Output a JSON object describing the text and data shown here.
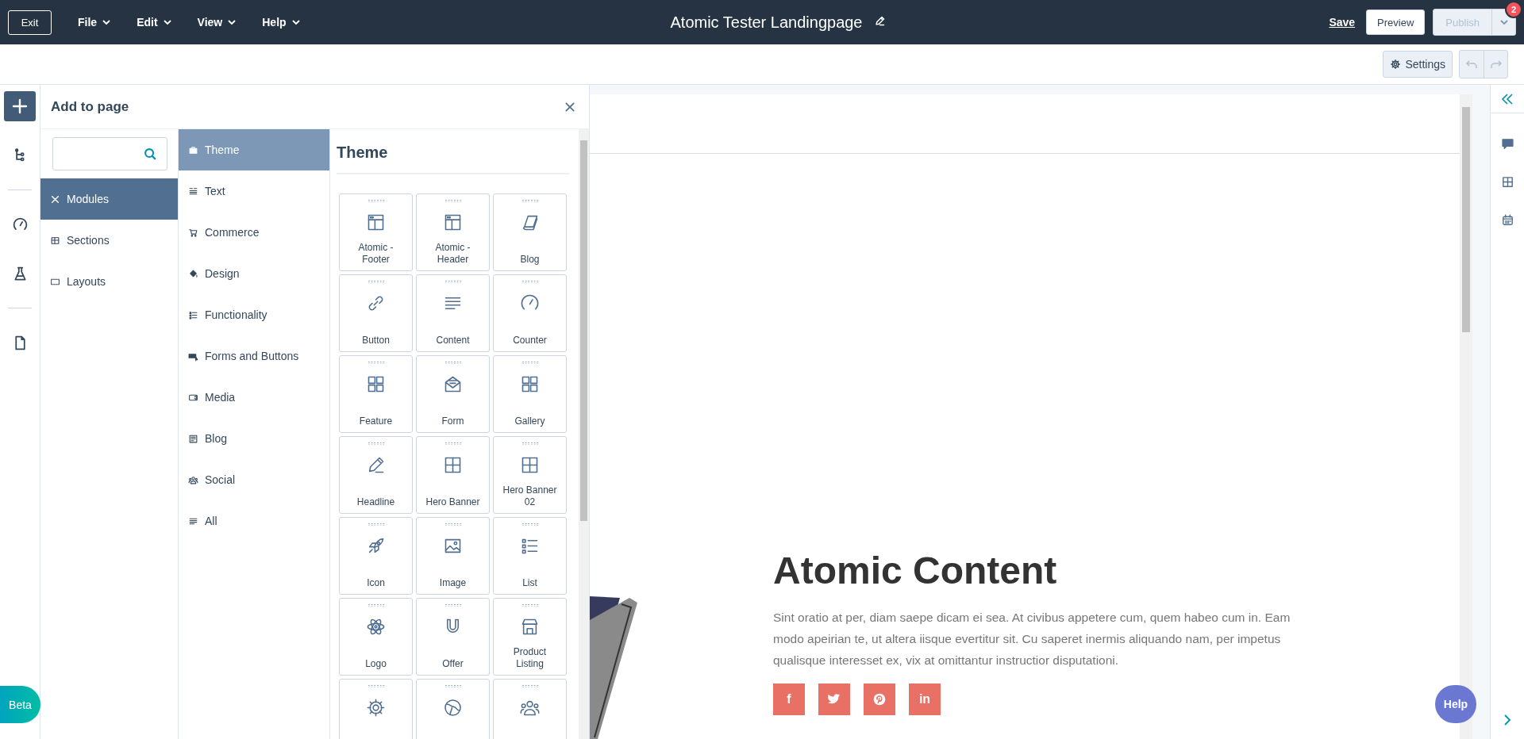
{
  "top_bar": {
    "exit": "Exit",
    "menus": [
      "File",
      "Edit",
      "View",
      "Help"
    ],
    "title": "Atomic Tester Landingpage",
    "save": "Save",
    "preview": "Preview",
    "publish": {
      "label": "Publish",
      "disabled": true
    },
    "notification_count": "2"
  },
  "toolbar": {
    "settings": "Settings"
  },
  "left_rail": [
    {
      "kind": "plus",
      "selected": true
    },
    {
      "kind": "tree",
      "selected": false
    },
    {
      "kind": "gauge",
      "selected": false
    },
    {
      "kind": "flask",
      "selected": false
    },
    {
      "kind": "file",
      "selected": false
    }
  ],
  "panel": {
    "title": "Add to page",
    "categories": [
      {
        "label": "Modules",
        "kind": "cross",
        "selected": true
      },
      {
        "label": "Sections",
        "kind": "section",
        "selected": false
      },
      {
        "label": "Layouts",
        "kind": "dashed",
        "selected": false
      }
    ],
    "subcategories": [
      {
        "label": "Theme",
        "kind": "briefcase",
        "selected": true
      },
      {
        "label": "Text",
        "kind": "text",
        "selected": false
      },
      {
        "label": "Commerce",
        "kind": "cart",
        "selected": false
      },
      {
        "label": "Design",
        "kind": "bucket",
        "selected": false
      },
      {
        "label": "Functionality",
        "kind": "list",
        "selected": false
      },
      {
        "label": "Forms and Buttons",
        "kind": "cursor",
        "selected": false
      },
      {
        "label": "Media",
        "kind": "media",
        "selected": false
      },
      {
        "label": "Blog",
        "kind": "blog",
        "selected": false
      },
      {
        "label": "Social",
        "kind": "people",
        "selected": false
      },
      {
        "label": "All",
        "kind": "lines",
        "selected": false
      }
    ],
    "modules_heading": "Theme",
    "modules": [
      {
        "label": "Atomic - Footer",
        "kind": "layout"
      },
      {
        "label": "Atomic - Header",
        "kind": "layout"
      },
      {
        "label": "Blog",
        "kind": "book"
      },
      {
        "label": "Button",
        "kind": "link"
      },
      {
        "label": "Content",
        "kind": "lines"
      },
      {
        "label": "Counter",
        "kind": "gauge"
      },
      {
        "label": "Feature",
        "kind": "numgrid"
      },
      {
        "label": "Form",
        "kind": "envelope"
      },
      {
        "label": "Gallery",
        "kind": "grid"
      },
      {
        "label": "Headline",
        "kind": "pencil"
      },
      {
        "label": "Hero Banner",
        "kind": "window"
      },
      {
        "label": "Hero Banner 02",
        "kind": "window"
      },
      {
        "label": "Icon",
        "kind": "rocket"
      },
      {
        "label": "Image",
        "kind": "image"
      },
      {
        "label": "List",
        "kind": "list"
      },
      {
        "label": "Logo",
        "kind": "atom"
      },
      {
        "label": "Offer",
        "kind": "magnet"
      },
      {
        "label": "Product Listing",
        "kind": "store"
      },
      {
        "kind": "gear"
      },
      {
        "kind": "globe"
      },
      {
        "kind": "people"
      }
    ]
  },
  "canvas": {
    "heading": "Atomic Content",
    "body": "Sint oratio at per, diam saepe dicam ei sea. At civibus appetere cum, quem habeo cum in. Eam modo apeirian te, ut altera iisque evertitur sit. Cu saperet inermis aliquando nam, per impetus qualisque interesset ex, vix at omittantur instructior disputationi.",
    "social": [
      {
        "kind": "text",
        "label": "f"
      },
      {
        "kind": "bird"
      },
      {
        "kind": "pin"
      },
      {
        "kind": "text",
        "label": "in"
      }
    ]
  },
  "right_rail": [
    {
      "kind": "chat"
    },
    {
      "kind": "window"
    },
    {
      "kind": "calendar"
    }
  ],
  "beta": "Beta",
  "help": "Help"
}
